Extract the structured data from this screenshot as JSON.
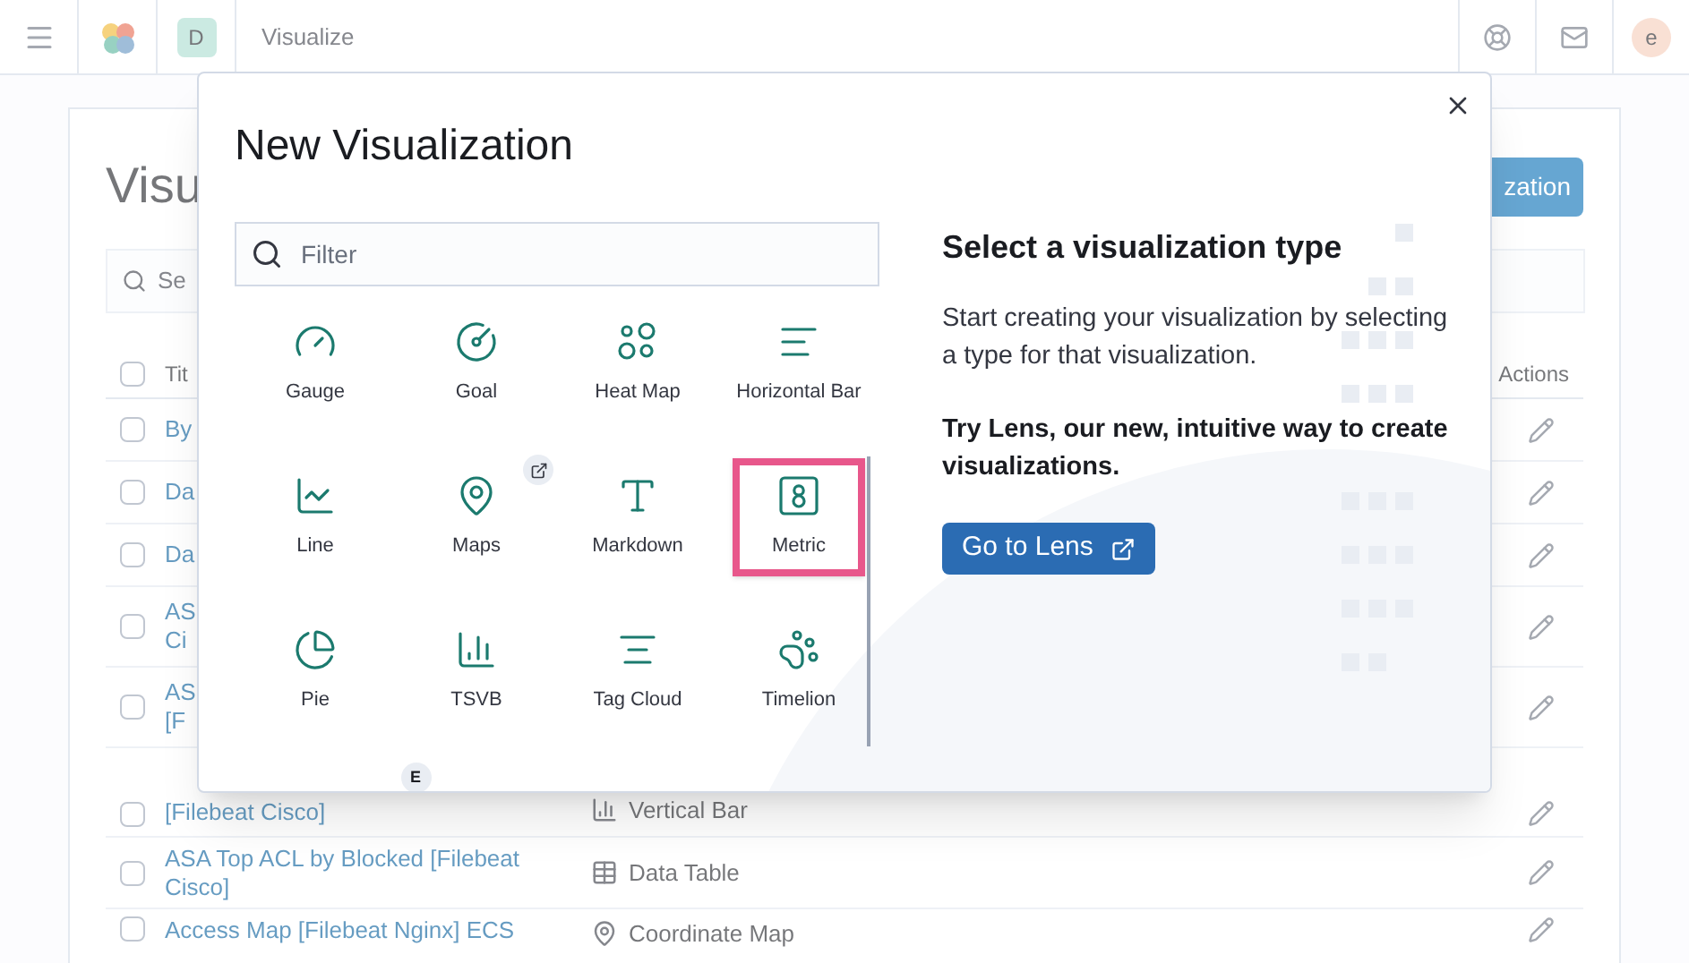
{
  "header": {
    "app_initial": "D",
    "breadcrumb": "Visualize",
    "avatar_initial": "e"
  },
  "page": {
    "title": "Visu",
    "create_button": "zation",
    "search_placeholder": "Se",
    "columns": {
      "title": "Tit",
      "actions": "Actions",
      "checked": false
    },
    "rows": [
      {
        "checked": false,
        "title": [
          "By"
        ]
      },
      {
        "checked": false,
        "title": [
          "Da"
        ]
      },
      {
        "checked": false,
        "title": [
          "Da"
        ]
      },
      {
        "checked": false,
        "title": [
          "AS",
          "Ci"
        ]
      },
      {
        "checked": false,
        "title": [
          "AS",
          "[F"
        ]
      },
      {
        "checked": false,
        "title": [
          "[Filebeat Cisco]"
        ],
        "type": "Vertical Bar"
      },
      {
        "checked": false,
        "title": [
          "ASA Top ACL by Blocked [Filebeat",
          "Cisco]"
        ],
        "type": "Data Table"
      },
      {
        "checked": false,
        "title": [
          "Access Map [Filebeat Nginx] ECS"
        ],
        "type": "Coordinate Map"
      }
    ]
  },
  "modal": {
    "title": "New Visualization",
    "filter_placeholder": "Filter",
    "types": [
      {
        "label": "Gauge",
        "external": false,
        "highlighted": false
      },
      {
        "label": "Goal",
        "external": false,
        "highlighted": false
      },
      {
        "label": "Heat Map",
        "external": false,
        "highlighted": false
      },
      {
        "label": "Horizontal Bar",
        "external": false,
        "highlighted": false
      },
      {
        "label": "Line",
        "external": false,
        "highlighted": false
      },
      {
        "label": "Maps",
        "external": true,
        "highlighted": false
      },
      {
        "label": "Markdown",
        "external": false,
        "highlighted": false
      },
      {
        "label": "Metric",
        "external": false,
        "highlighted": true
      },
      {
        "label": "Pie",
        "external": false,
        "highlighted": false
      },
      {
        "label": "TSVB",
        "external": false,
        "highlighted": false
      },
      {
        "label": "Tag Cloud",
        "external": false,
        "highlighted": false
      },
      {
        "label": "Timelion",
        "external": false,
        "highlighted": false
      }
    ],
    "partial_badge": "E",
    "side": {
      "heading": "Select a visualization type",
      "text": "Start creating your visualization by selecting a type for that visualization.",
      "lens_text": "Try Lens, our new, intuitive way to create visualizations.",
      "button": "Go to Lens"
    }
  }
}
